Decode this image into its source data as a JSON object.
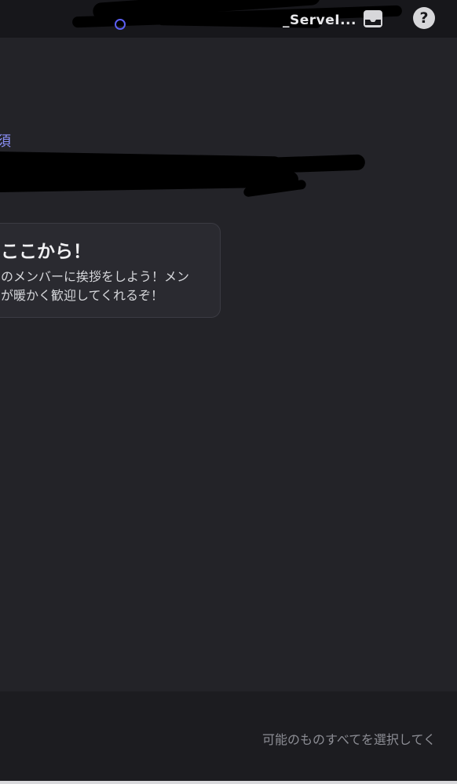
{
  "header": {
    "server_name": "_ServeI...",
    "inbox_icon": "inbox-icon",
    "help_icon": "help-icon",
    "help_glyph": "?"
  },
  "main": {
    "required_label": "須",
    "tip_card": {
      "title": "ここから！",
      "body": "のメンバーに挨拶をしよう！メン\nが暖かく歓迎してくれるぞ！"
    }
  },
  "footer": {
    "hint_text": "可能のものすべてを選択してく"
  },
  "colors": {
    "accent": "#8b90f7",
    "background": "#232328",
    "topbar": "#17171b"
  }
}
